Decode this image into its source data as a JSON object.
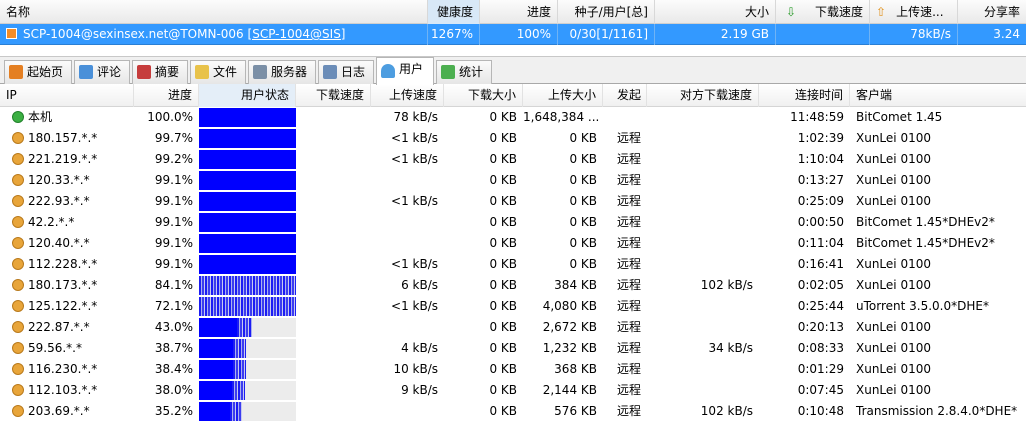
{
  "top_header": {
    "name": "名称",
    "health": "健康度",
    "progress": "进度",
    "seeds": "种子/用户[总]",
    "size": "大小",
    "download_speed": "下载速度",
    "upload_speed": "上传速...",
    "share_ratio": "分享率"
  },
  "task": {
    "name_prefix": "SCP-1004@sexinsex.net@TOMN-006",
    "name_link": "[SCP-1004@SIS]",
    "health": "1267%",
    "progress": "100%",
    "seeds": "0/30[1/1161]",
    "size": "2.19 GB",
    "download_speed": "",
    "upload_speed": "78kB/s",
    "share_ratio": "3.24"
  },
  "tabs": [
    {
      "label": "起始页",
      "icon": "home-icon"
    },
    {
      "label": "评论",
      "icon": "comment-icon"
    },
    {
      "label": "摘要",
      "icon": "summary-icon"
    },
    {
      "label": "文件",
      "icon": "folder-icon"
    },
    {
      "label": "服务器",
      "icon": "server-icon"
    },
    {
      "label": "日志",
      "icon": "log-icon"
    },
    {
      "label": "用户",
      "icon": "users-icon",
      "active": true
    },
    {
      "label": "统计",
      "icon": "stats-icon"
    }
  ],
  "columns": {
    "ip": "IP",
    "progress": "进度",
    "status": "用户状态",
    "dl_speed": "下载速度",
    "ul_speed": "上传速度",
    "dl_size": "下载大小",
    "ul_size": "上传大小",
    "initiator": "发起",
    "remote_dl_speed": "对方下载速度",
    "conn_time": "连接时间",
    "client": "客户端"
  },
  "peers": [
    {
      "ip": "本机",
      "progress": "100.0%",
      "fill": 1.0,
      "dl": "",
      "ul": "78 kB/s",
      "dls": "0 KB",
      "uls": "1,648,384 ...",
      "init": "",
      "rdl": "",
      "time": "11:48:59",
      "client": "BitComet 1.45",
      "self": true
    },
    {
      "ip": "180.157.*.*",
      "progress": "99.7%",
      "fill": 0.997,
      "dl": "",
      "ul": "<1 kB/s",
      "dls": "0 KB",
      "uls": "0 KB",
      "init": "远程",
      "rdl": "",
      "time": "1:02:39",
      "client": "XunLei 0100"
    },
    {
      "ip": "221.219.*.*",
      "progress": "99.2%",
      "fill": 0.992,
      "dl": "",
      "ul": "<1 kB/s",
      "dls": "0 KB",
      "uls": "0 KB",
      "init": "远程",
      "rdl": "",
      "time": "1:10:04",
      "client": "XunLei 0100"
    },
    {
      "ip": "120.33.*.*",
      "progress": "99.1%",
      "fill": 0.991,
      "dl": "",
      "ul": "",
      "dls": "0 KB",
      "uls": "0 KB",
      "init": "远程",
      "rdl": "",
      "time": "0:13:27",
      "client": "XunLei 0100"
    },
    {
      "ip": "222.93.*.*",
      "progress": "99.1%",
      "fill": 0.991,
      "dl": "",
      "ul": "<1 kB/s",
      "dls": "0 KB",
      "uls": "0 KB",
      "init": "远程",
      "rdl": "",
      "time": "0:25:09",
      "client": "XunLei 0100"
    },
    {
      "ip": "42.2.*.*",
      "progress": "99.1%",
      "fill": 0.991,
      "dl": "",
      "ul": "",
      "dls": "0 KB",
      "uls": "0 KB",
      "init": "远程",
      "rdl": "",
      "time": "0:00:50",
      "client": "BitComet 1.45*DHEv2*"
    },
    {
      "ip": "120.40.*.*",
      "progress": "99.1%",
      "fill": 0.991,
      "dl": "",
      "ul": "",
      "dls": "0 KB",
      "uls": "0 KB",
      "init": "远程",
      "rdl": "",
      "time": "0:11:04",
      "client": "BitComet 1.45*DHEv2*"
    },
    {
      "ip": "112.228.*.*",
      "progress": "99.1%",
      "fill": 0.991,
      "dl": "",
      "ul": "<1 kB/s",
      "dls": "0 KB",
      "uls": "0 KB",
      "init": "远程",
      "rdl": "",
      "time": "0:16:41",
      "client": "XunLei 0100"
    },
    {
      "ip": "180.173.*.*",
      "progress": "84.1%",
      "fill": 0.841,
      "dl": "",
      "ul": "6 kB/s",
      "dls": "0 KB",
      "uls": "384 KB",
      "init": "远程",
      "rdl": "102 kB/s",
      "time": "0:02:05",
      "client": "XunLei 0100"
    },
    {
      "ip": "125.122.*.*",
      "progress": "72.1%",
      "fill": 0.721,
      "dl": "",
      "ul": "<1 kB/s",
      "dls": "0 KB",
      "uls": "4,080 KB",
      "init": "远程",
      "rdl": "",
      "time": "0:25:44",
      "client": "uTorrent 3.5.0.0*DHE*"
    },
    {
      "ip": "222.87.*.*",
      "progress": "43.0%",
      "fill": 0.43,
      "dl": "",
      "ul": "",
      "dls": "0 KB",
      "uls": "2,672 KB",
      "init": "远程",
      "rdl": "",
      "time": "0:20:13",
      "client": "XunLei 0100"
    },
    {
      "ip": "59.56.*.*",
      "progress": "38.7%",
      "fill": 0.387,
      "dl": "",
      "ul": "4 kB/s",
      "dls": "0 KB",
      "uls": "1,232 KB",
      "init": "远程",
      "rdl": "34 kB/s",
      "time": "0:08:33",
      "client": "XunLei 0100"
    },
    {
      "ip": "116.230.*.*",
      "progress": "38.4%",
      "fill": 0.384,
      "dl": "",
      "ul": "10 kB/s",
      "dls": "0 KB",
      "uls": "368 KB",
      "init": "远程",
      "rdl": "",
      "time": "0:01:29",
      "client": "XunLei 0100"
    },
    {
      "ip": "112.103.*.*",
      "progress": "38.0%",
      "fill": 0.38,
      "dl": "",
      "ul": "9 kB/s",
      "dls": "0 KB",
      "uls": "2,144 KB",
      "init": "远程",
      "rdl": "",
      "time": "0:07:45",
      "client": "XunLei 0100"
    },
    {
      "ip": "203.69.*.*",
      "progress": "35.2%",
      "fill": 0.352,
      "dl": "",
      "ul": "",
      "dls": "0 KB",
      "uls": "576 KB",
      "init": "远程",
      "rdl": "102 kB/s",
      "time": "0:10:48",
      "client": "Transmission 2.8.4.0*DHE*"
    }
  ]
}
